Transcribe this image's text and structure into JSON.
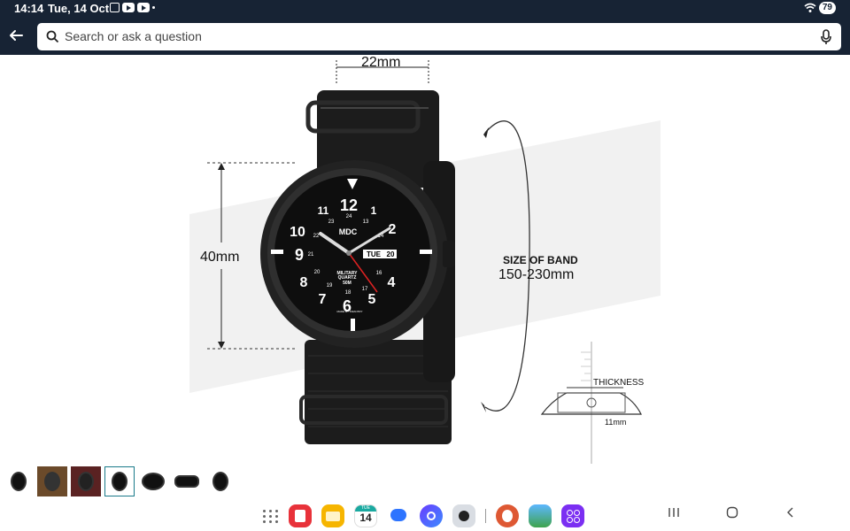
{
  "status_bar": {
    "time": "14:14",
    "date": "Tue, 14 Oct",
    "battery": "79"
  },
  "search": {
    "placeholder": "Search or ask a question"
  },
  "product_image": {
    "strap_width": "22mm",
    "case_size": "40mm",
    "band_title": "SIZE OF BAND",
    "band_size": "150-230mm",
    "thickness_label": "THICKNESS",
    "thickness_value": "11mm",
    "dial_brand": "MDC",
    "dial_text_1": "MILITARY",
    "dial_text_2": "QUARTZ",
    "dial_text_3": "50M",
    "dial_day": "TUE",
    "dial_date": "20",
    "dial_bottom": "MADE BY INFANTRY"
  },
  "thumbnails": [
    {
      "name": "thumb-1",
      "active": false
    },
    {
      "name": "thumb-2",
      "active": false
    },
    {
      "name": "thumb-3",
      "active": false
    },
    {
      "name": "thumb-4",
      "active": true
    },
    {
      "name": "thumb-5",
      "active": false
    },
    {
      "name": "thumb-6",
      "active": false
    },
    {
      "name": "thumb-7",
      "active": false
    }
  ],
  "taskbar": {
    "calendar_day": "14",
    "calendar_label": "TUE"
  },
  "colors": {
    "header_bg": "#172334",
    "accent_teal": "#1a7a8a"
  }
}
